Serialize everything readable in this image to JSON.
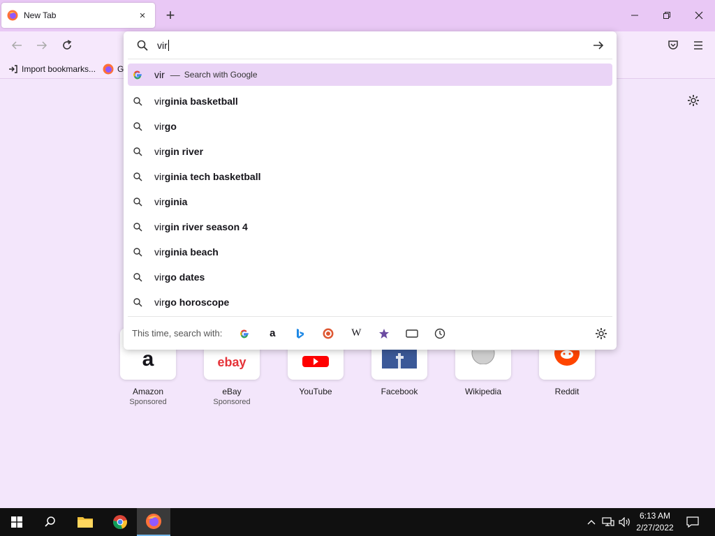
{
  "tab": {
    "title": "New Tab",
    "close": "×"
  },
  "newtab": "+",
  "window_controls": {
    "minimize": "—",
    "maximize": "❐",
    "close": "✕"
  },
  "bookmarks": {
    "import": "Import bookmarks...",
    "second": "G"
  },
  "urlbar": {
    "typed": "vir"
  },
  "first_result": {
    "typed": "vir",
    "dash": "—",
    "action": "Search with Google"
  },
  "suggestions": [
    {
      "typed": "vir",
      "suffix": "ginia basketball"
    },
    {
      "typed": "vir",
      "suffix": "go"
    },
    {
      "typed": "vir",
      "suffix": "gin river"
    },
    {
      "typed": "vir",
      "suffix": "ginia tech basketball"
    },
    {
      "typed": "vir",
      "suffix": "ginia"
    },
    {
      "typed": "vir",
      "suffix": "gin river season 4"
    },
    {
      "typed": "vir",
      "suffix": "ginia beach"
    },
    {
      "typed": "vir",
      "suffix": "go dates"
    },
    {
      "typed": "vir",
      "suffix": "go horoscope"
    }
  ],
  "onetime": {
    "label": "This time, search with:",
    "engines": [
      "google-icon",
      "amazon-icon",
      "bing-icon",
      "duckduckgo-icon",
      "wikipedia-icon",
      "bookmarks-icon",
      "tabs-icon",
      "history-icon"
    ],
    "wikipedia_glyph": "W",
    "amazon_glyph": "a"
  },
  "shortcuts": [
    {
      "label": "Amazon",
      "sub": "Sponsored"
    },
    {
      "label": "eBay",
      "sub": "Sponsored"
    },
    {
      "label": "YouTube",
      "sub": ""
    },
    {
      "label": "Facebook",
      "sub": ""
    },
    {
      "label": "Wikipedia",
      "sub": ""
    },
    {
      "label": "Reddit",
      "sub": ""
    }
  ],
  "shortcut_glyphs": {
    "amazon": "a",
    "ebay": "ebay"
  },
  "taskbar": {
    "time": "6:13 AM",
    "date": "2/27/2022"
  },
  "colors": {
    "tabstrip": "#e9c8f5",
    "content": "#f3e6fb",
    "highlight": "#ead4f6",
    "taskbar": "#101010"
  }
}
